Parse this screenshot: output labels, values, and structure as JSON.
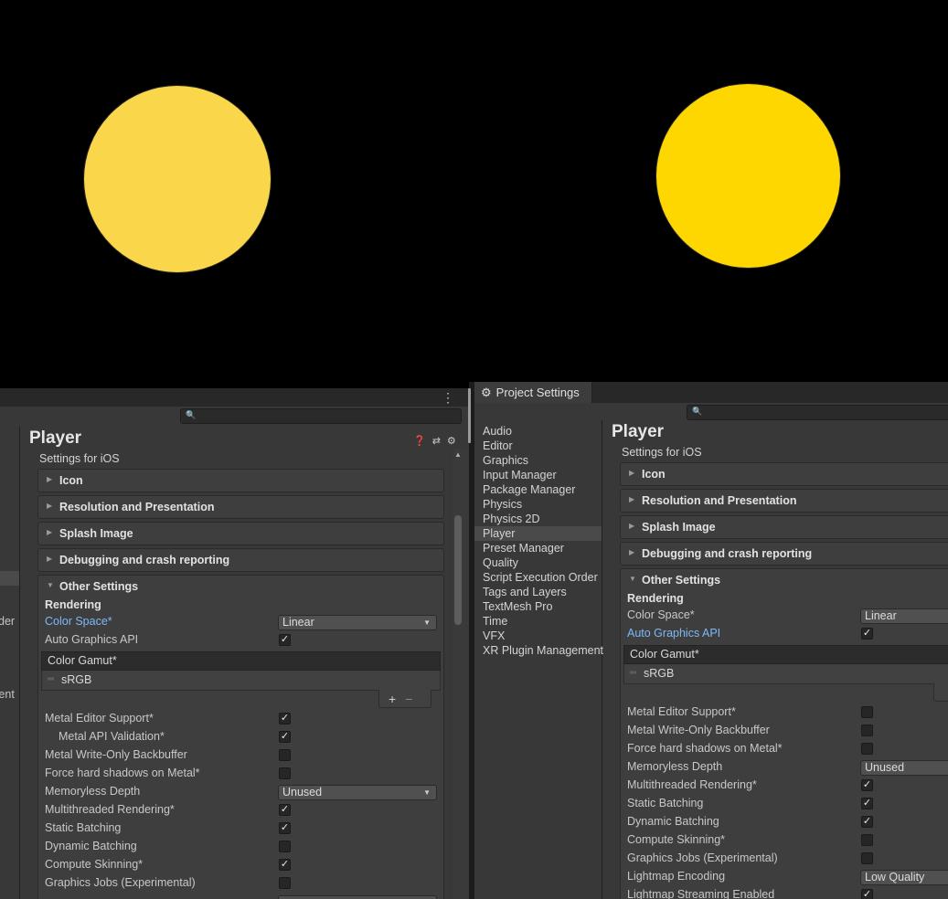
{
  "colors": {
    "left_circle": "#fad64b",
    "right_circle": "#ffd700",
    "panel_bg": "#383838",
    "highlight_blue": "#7eb8f7"
  },
  "left_panel": {
    "strip_fragments": [
      "der",
      "ment"
    ],
    "title": "Player",
    "settings_for": "Settings for iOS",
    "foldouts": [
      "Icon",
      "Resolution and Presentation",
      "Splash Image",
      "Debugging and crash reporting"
    ],
    "other_settings": {
      "title": "Other Settings",
      "rendering_heading": "Rendering",
      "color_space_label": "Color Space*",
      "color_space_value": "Linear",
      "auto_graphics_label": "Auto Graphics API",
      "auto_graphics_checked": true,
      "color_gamut_label": "Color Gamut*",
      "color_gamut_value": "sRGB",
      "add_label": "+",
      "remove_label": "−",
      "rows": [
        {
          "label": "Metal Editor Support*",
          "type": "checkbox",
          "checked": true
        },
        {
          "label": "Metal API Validation*",
          "type": "checkbox",
          "checked": true,
          "indent": true
        },
        {
          "label": "Metal Write-Only Backbuffer",
          "type": "checkbox",
          "checked": false
        },
        {
          "label": "Force hard shadows on Metal*",
          "type": "checkbox",
          "checked": false
        },
        {
          "label": "Memoryless Depth",
          "type": "dropdown",
          "value": "Unused"
        },
        {
          "label": "Multithreaded Rendering*",
          "type": "checkbox",
          "checked": true
        },
        {
          "label": "Static Batching",
          "type": "checkbox",
          "checked": true
        },
        {
          "label": "Dynamic Batching",
          "type": "checkbox",
          "checked": false
        },
        {
          "label": "Compute Skinning*",
          "type": "checkbox",
          "checked": true
        },
        {
          "label": "Graphics Jobs (Experimental)",
          "type": "checkbox",
          "checked": false
        }
      ]
    }
  },
  "right_panel": {
    "tab_title": "Project Settings",
    "sidebar": {
      "items": [
        "Audio",
        "Editor",
        "Graphics",
        "Input Manager",
        "Package Manager",
        "Physics",
        "Physics 2D",
        "Player",
        "Preset Manager",
        "Quality",
        "Script Execution Order",
        "Tags and Layers",
        "TextMesh Pro",
        "Time",
        "VFX",
        "XR Plugin Management"
      ],
      "selected": "Player"
    },
    "title": "Player",
    "settings_for": "Settings for iOS",
    "foldouts": [
      "Icon",
      "Resolution and Presentation",
      "Splash Image",
      "Debugging and crash reporting"
    ],
    "other_settings": {
      "title": "Other Settings",
      "rendering_heading": "Rendering",
      "color_space_label": "Color Space*",
      "color_space_value": "Linear",
      "auto_graphics_label": "Auto Graphics API",
      "auto_graphics_checked": true,
      "color_gamut_label": "Color Gamut*",
      "color_gamut_value": "sRGB",
      "rows": [
        {
          "label": "Metal Editor Support*",
          "type": "checkbox",
          "checked": false
        },
        {
          "label": "Metal Write-Only Backbuffer",
          "type": "checkbox",
          "checked": false
        },
        {
          "label": "Force hard shadows on Metal*",
          "type": "checkbox",
          "checked": false
        },
        {
          "label": "Memoryless Depth",
          "type": "dropdown",
          "value": "Unused"
        },
        {
          "label": "Multithreaded Rendering*",
          "type": "checkbox",
          "checked": true
        },
        {
          "label": "Static Batching",
          "type": "checkbox",
          "checked": true
        },
        {
          "label": "Dynamic Batching",
          "type": "checkbox",
          "checked": true
        },
        {
          "label": "Compute Skinning*",
          "type": "checkbox",
          "checked": false
        },
        {
          "label": "Graphics Jobs (Experimental)",
          "type": "checkbox",
          "checked": false
        },
        {
          "label": "Lightmap Encoding",
          "type": "dropdown",
          "value": "Low Quality"
        },
        {
          "label": "Lightmap Streaming Enabled",
          "type": "checkbox",
          "checked": true
        }
      ]
    }
  }
}
